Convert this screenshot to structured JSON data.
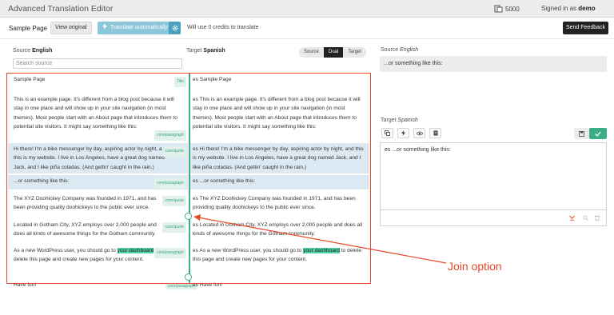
{
  "app": {
    "title": "Advanced Translation Editor",
    "credits": "5000",
    "signed_in_prefix": "Signed in as",
    "user": "demo"
  },
  "toolbar": {
    "page_name": "Sample Page",
    "view_original": "View original",
    "translate_auto": "Translate automatically",
    "credits_note": "Will use 0 credits to translate",
    "send_feedback": "Send Feedback"
  },
  "columns": {
    "source_label": "Source",
    "source_lang": "English",
    "target_label": "Target",
    "target_lang": "Spanish",
    "search_placeholder": "Search source",
    "view_modes": [
      "Source",
      "Dual",
      "Target"
    ],
    "active_mode": "Dual"
  },
  "segments": [
    {
      "source": "Sample Page",
      "target": "es Sample Page",
      "tag": "Title"
    },
    {
      "source": "This is an example page. It's different from a blog post because it will stay in one place and will show up in your site navigation (in most themes). Most people start with an About page that introduces them to potential site visitors. It might say something like this:",
      "target": "es This is an example page. It's different from a blog post because it will stay in one place and will show up in your site navigation (in most themes). Most people start with an About page that introduces them to potential site visitors. It might say something like this:",
      "tag": "core/paragraph"
    },
    {
      "source": "Hi there! I'm a bike messenger by day, aspiring actor by night, and this is my website. I live in Los Angeles, have a great dog named Jack, and I like piña coladas. (And gettin' caught in the rain.)",
      "target": "es Hi there! I'm a bike messenger by day, aspiring actor by night, and this is my website. I live in Los Angeles, have a great dog named Jack, and I like piña coladas. (And gettin' caught in the rain.)",
      "tag": "core/quote"
    },
    {
      "source": "...or something like this:",
      "target": "es ...or something like this:",
      "tag": "core/paragraph"
    },
    {
      "source": "The XYZ Doohickey Company was founded in 1971, and has been providing quality doohickeys to the public ever since.",
      "target": "es The XYZ Doohickey Company was founded in 1971, and has been providing quality doohickeys to the public ever since.",
      "tag": "core/quote"
    },
    {
      "source": "Located in Gotham City, XYZ employs over 2,000 people and does all kinds of awesome things for the Gotham community.",
      "target": "es Located in Gotham City, XYZ employs over 2,000 people and does all kinds of awesome things for the Gotham community.",
      "tag": "core/quote"
    },
    {
      "source_pre": "As a new WordPress user, you should go to ",
      "source_mark": "your dashboard",
      "source_post": " to delete this page and create new pages for your content.",
      "target_pre": "es As a new WordPress user, you should go to ",
      "target_mark": "your dashboard",
      "target_post": " to delete this page and create new pages for your content.",
      "tag": "core/paragraph"
    },
    {
      "source": "Have fun!",
      "target": "es Have fun!",
      "tag": "core/paragraph"
    }
  ],
  "right_panel": {
    "source_label": "Source",
    "source_lang": "English",
    "source_text": "...or something like this:",
    "target_label": "Target",
    "target_lang": "Spanish",
    "target_text": "es ...or something like this:"
  },
  "annotation": {
    "label": "Join option",
    "color": "#e8492a"
  }
}
